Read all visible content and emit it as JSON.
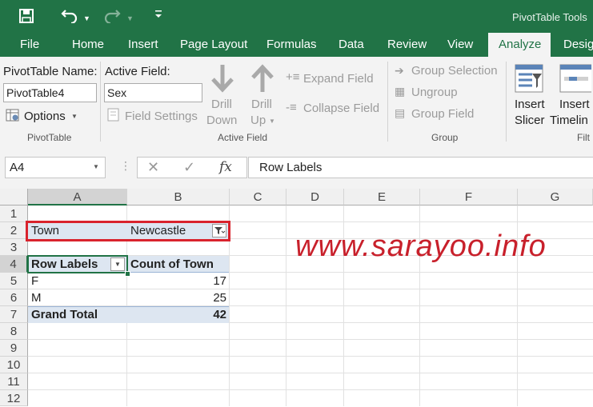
{
  "title_bar": {
    "context_title": "PivotTable Tools"
  },
  "tabs": [
    "File",
    "Home",
    "Insert",
    "Page Layout",
    "Formulas",
    "Data",
    "Review",
    "View",
    "Analyze",
    "Desig"
  ],
  "ribbon": {
    "pivottable": {
      "name_label": "PivotTable Name:",
      "name_value": "PivotTable4",
      "options_label": "Options",
      "group_label": "PivotTable"
    },
    "active_field": {
      "label": "Active Field:",
      "value": "Sex",
      "field_settings": "Field Settings",
      "drill_down_1": "Drill",
      "drill_down_2": "Down",
      "drill_up_1": "Drill",
      "drill_up_2": "Up",
      "expand_field": "Expand Field",
      "collapse_field": "Collapse Field",
      "group_label": "Active Field"
    },
    "group": {
      "group_selection": "Group Selection",
      "ungroup": "Ungroup",
      "group_field": "Group Field",
      "group_label": "Group"
    },
    "filter": {
      "insert_slicer_1": "Insert",
      "insert_slicer_2": "Slicer",
      "insert_timeline_1": "Insert",
      "insert_timeline_2": "Timelin",
      "group_label": "Filt"
    }
  },
  "formula_bar": {
    "name_box": "A4",
    "fx": "fx",
    "formula": "Row Labels"
  },
  "columns": [
    "A",
    "B",
    "C",
    "D",
    "E",
    "F",
    "G"
  ],
  "rows": [
    "1",
    "2",
    "3",
    "4",
    "5",
    "6",
    "7",
    "8",
    "9",
    "10",
    "11",
    "12"
  ],
  "pivot": {
    "filter_field": "Town",
    "filter_value": "Newcastle",
    "row_labels_header": "Row Labels",
    "value_header": "Count of Town",
    "items": [
      {
        "label": "F",
        "value": "17"
      },
      {
        "label": "M",
        "value": "25"
      }
    ],
    "grand_total_label": "Grand Total",
    "grand_total_value": "42"
  },
  "watermark": "www.sarayoo.info",
  "colors": {
    "excel_green": "#217346",
    "highlight_box": "#d9232d",
    "pivot_header_fill": "#dde6f1",
    "watermark": "#c8202b"
  }
}
